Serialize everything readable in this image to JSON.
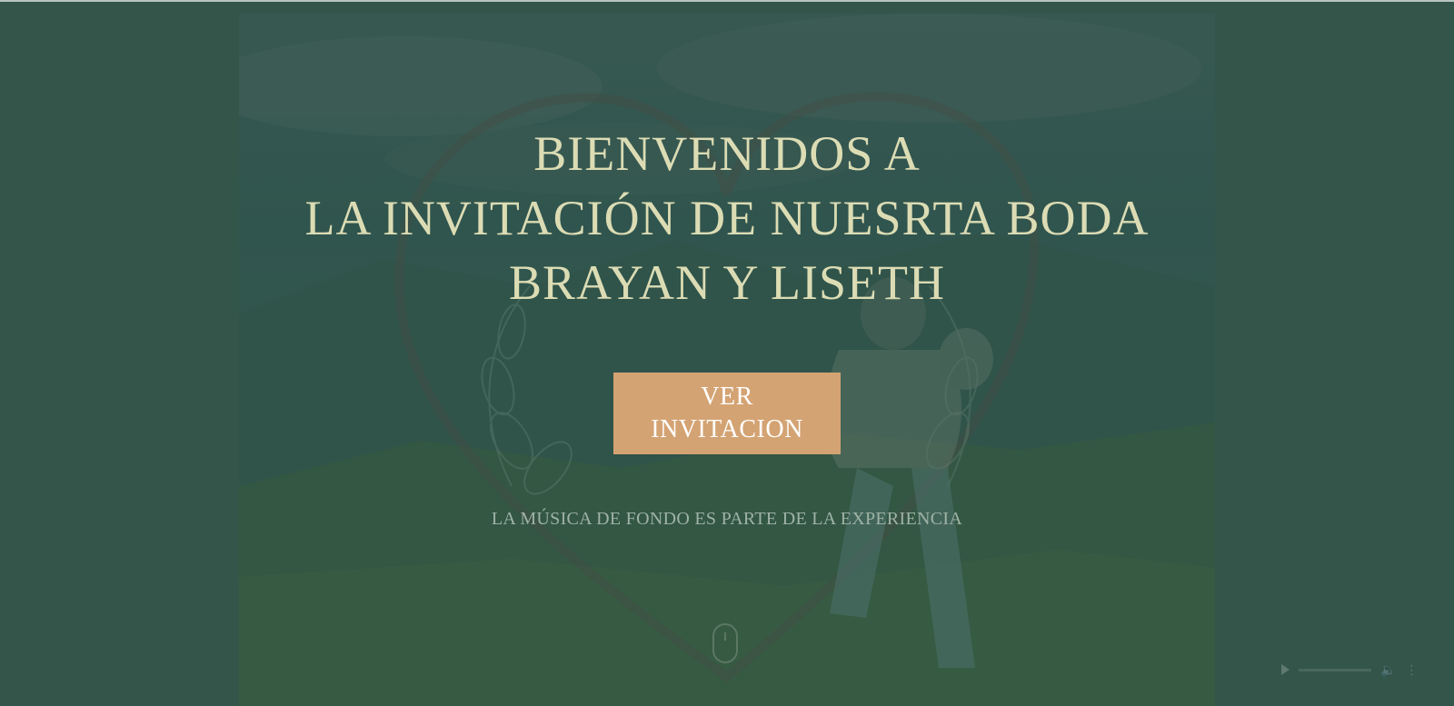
{
  "hero": {
    "line1": "BIENVENIDOS A",
    "line2": "LA INVITACIÓN DE NUESRTA BODA",
    "line3": "BRAYAN Y LISETH"
  },
  "cta": {
    "line1": "VER",
    "line2": "INVITACION"
  },
  "music_note": "LA MÚSICA DE FONDO ES PARTE DE LA EXPERIENCIA",
  "audio_player": {
    "play_icon": "play-icon",
    "volume_icon": "volume-icon",
    "more_icon": "more-vertical-icon"
  },
  "colors": {
    "background": "#34554b",
    "title_text": "#dcdcb4",
    "button_bg": "#d4a373",
    "button_text": "#ffffff",
    "subtitle_text": "#9fb3a6"
  }
}
